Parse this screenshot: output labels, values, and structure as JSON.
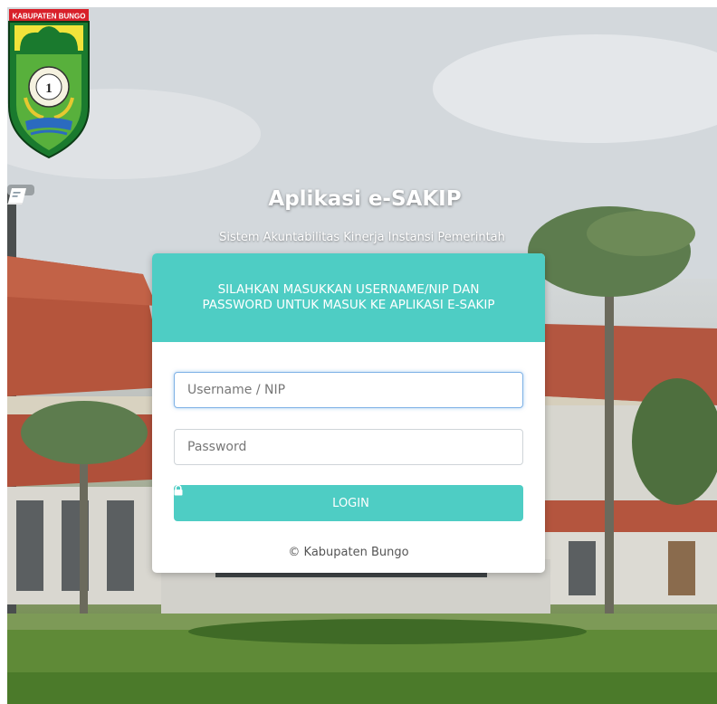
{
  "emblem": {
    "banner_text": "KABUPATEN BUNGO"
  },
  "app": {
    "title": "Aplikasi e-SAKIP",
    "subtitle": "Sistem Akuntabilitas Kinerja Instansi Pemerintah"
  },
  "login_card": {
    "header_line1": "SILAHKAN MASUKKAN USERNAME/NIP DAN",
    "header_line2": "PASSWORD UNTUK MASUK KE APLIKASI E-SAKIP",
    "username_placeholder": "Username / NIP",
    "password_placeholder": "Password",
    "login_label": "LOGIN",
    "footer": "© Kabupaten Bungo"
  },
  "colors": {
    "accent": "#4ecdc4",
    "focus_border": "#7fb2e6"
  },
  "icons": {
    "title_icon": "book-icon",
    "button_icon": "lock-icon"
  }
}
